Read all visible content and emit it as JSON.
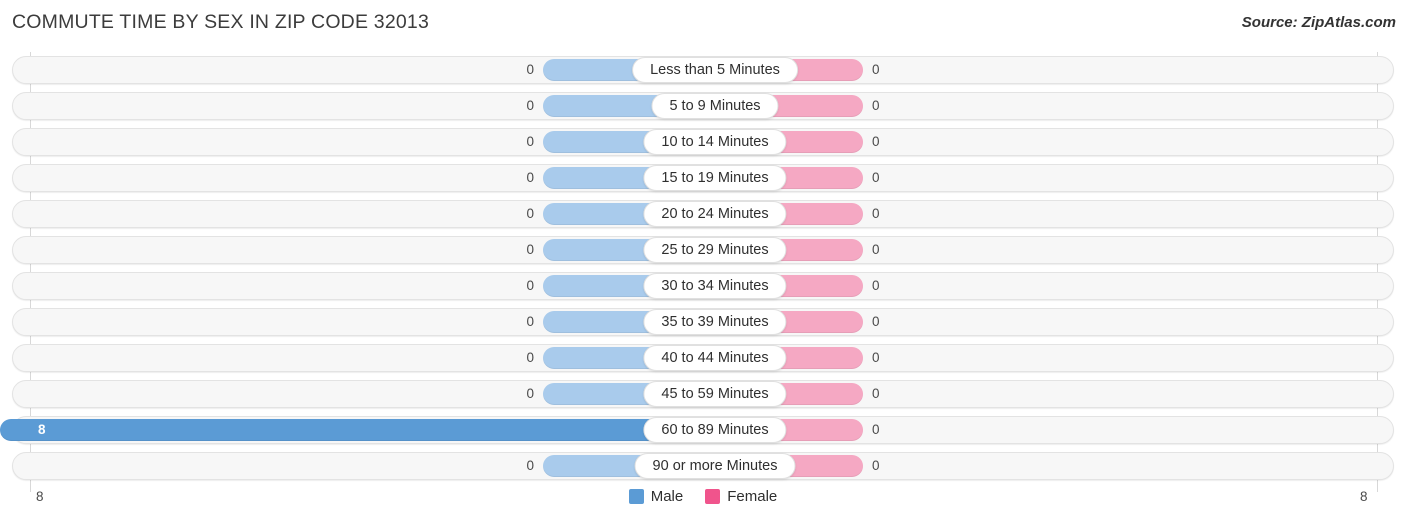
{
  "header": {
    "title": "COMMUTE TIME BY SEX IN ZIP CODE 32013",
    "source": "Source: ZipAtlas.com"
  },
  "axis": {
    "left_label": "8",
    "right_label": "8"
  },
  "legend": {
    "items": [
      {
        "label": "Male",
        "color": "#5b9bd5"
      },
      {
        "label": "Female",
        "color": "#f0548c"
      }
    ]
  },
  "colors": {
    "male_light": "#a9cbec",
    "male_dark": "#5b9bd5",
    "female_light": "#f5a8c3",
    "female_dark": "#f0548c",
    "track": "#f7f7f7",
    "gridline": "#d8d8d8"
  },
  "chart_data": {
    "type": "bar",
    "subtype": "diverging-bidirectional",
    "title": "COMMUTE TIME BY SEX IN ZIP CODE 32013",
    "xlabel": "",
    "ylabel": "",
    "xlim": [
      8,
      8
    ],
    "grid": true,
    "legend_position": "bottom-center",
    "categories": [
      "Less than 5 Minutes",
      "5 to 9 Minutes",
      "10 to 14 Minutes",
      "15 to 19 Minutes",
      "20 to 24 Minutes",
      "25 to 29 Minutes",
      "30 to 34 Minutes",
      "35 to 39 Minutes",
      "40 to 44 Minutes",
      "45 to 59 Minutes",
      "60 to 89 Minutes",
      "90 or more Minutes"
    ],
    "series": [
      {
        "name": "Male",
        "values": [
          0,
          0,
          0,
          0,
          0,
          0,
          0,
          0,
          0,
          0,
          8,
          0
        ],
        "labels": [
          "0",
          "0",
          "0",
          "0",
          "0",
          "0",
          "0",
          "0",
          "0",
          "0",
          "8",
          "0"
        ]
      },
      {
        "name": "Female",
        "values": [
          0,
          0,
          0,
          0,
          0,
          0,
          0,
          0,
          0,
          0,
          0,
          0
        ],
        "labels": [
          "0",
          "0",
          "0",
          "0",
          "0",
          "0",
          "0",
          "0",
          "0",
          "0",
          "0",
          "0"
        ]
      }
    ],
    "axis_ticks": [
      "8",
      "8"
    ]
  }
}
